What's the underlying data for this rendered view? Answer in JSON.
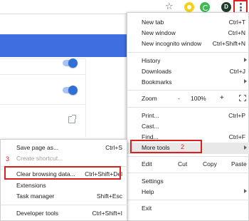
{
  "toolbar": {
    "icons": [
      "star-icon",
      "extension-yellow-icon",
      "extension-green-icon",
      "profile-avatar",
      "kebab-menu-icon"
    ],
    "avatar_letter": "D"
  },
  "chrome_menu": {
    "new_tab": {
      "label": "New tab",
      "shortcut": "Ctrl+T"
    },
    "new_window": {
      "label": "New window",
      "shortcut": "Ctrl+N"
    },
    "new_incognito": {
      "label": "New incognito window",
      "shortcut": "Ctrl+Shift+N"
    },
    "history": {
      "label": "History"
    },
    "downloads": {
      "label": "Downloads",
      "shortcut": "Ctrl+J"
    },
    "bookmarks": {
      "label": "Bookmarks"
    },
    "zoom": {
      "label": "Zoom",
      "minus": "-",
      "level": "100%",
      "plus": "+"
    },
    "print": {
      "label": "Print...",
      "shortcut": "Ctrl+P"
    },
    "cast": {
      "label": "Cast..."
    },
    "find": {
      "label": "Find...",
      "shortcut": "Ctrl+F"
    },
    "more_tools": {
      "label": "More tools"
    },
    "edit": {
      "label": "Edit",
      "cut": "Cut",
      "copy": "Copy",
      "paste": "Paste"
    },
    "settings": {
      "label": "Settings"
    },
    "help": {
      "label": "Help"
    },
    "exit": {
      "label": "Exit"
    }
  },
  "more_tools_submenu": {
    "save_page": {
      "label": "Save page as...",
      "shortcut": "Ctrl+S"
    },
    "create_shortcut": {
      "label": "Create shortcut..."
    },
    "clear_browsing": {
      "label": "Clear browsing data...",
      "shortcut": "Ctrl+Shift+Del"
    },
    "extensions": {
      "label": "Extensions"
    },
    "task_manager": {
      "label": "Task manager",
      "shortcut": "Shift+Esc"
    },
    "developer_tools": {
      "label": "Developer tools",
      "shortcut": "Ctrl+Shift+I"
    }
  },
  "annotations": {
    "step2": "2",
    "step3": "3",
    "highlight_color": "#d9201f"
  },
  "colors": {
    "accent_blue": "#3f6ee0",
    "toggle_blue": "#2f6fd6"
  }
}
